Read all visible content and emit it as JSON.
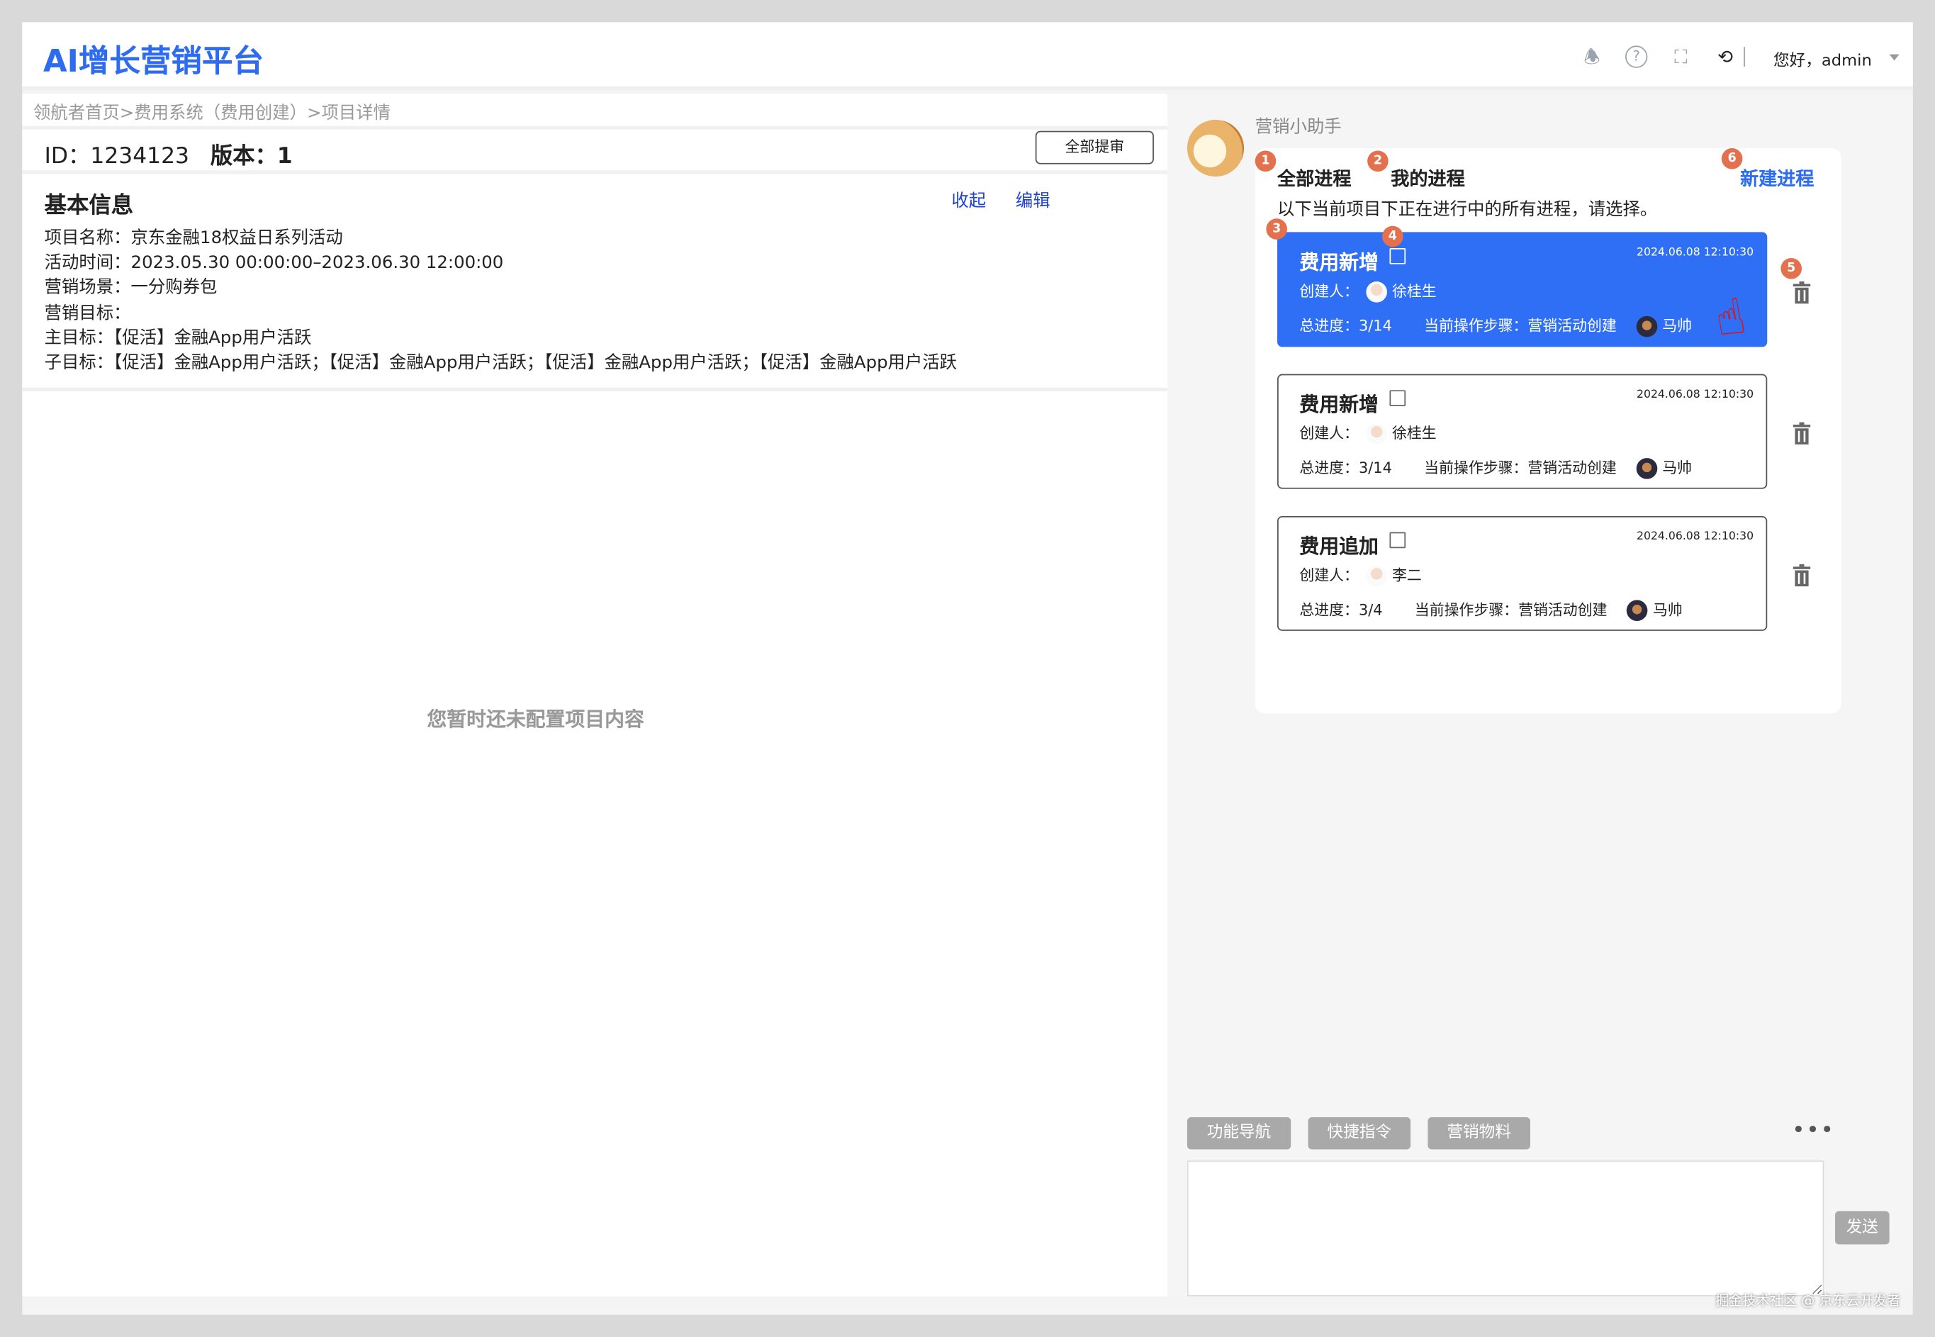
{
  "header": {
    "title": "AI增长营销平台",
    "greeting": "您好，admin",
    "icons": [
      "bell-icon",
      "help-icon",
      "fullscreen-icon",
      "history-icon"
    ]
  },
  "left": {
    "breadcrumb": "领航者首页>费用系统（费用创建）>项目详情",
    "id_label": "ID：1234123",
    "version_label": "版本：1",
    "submit_all": "全部提审",
    "basic_info": {
      "title": "基本信息",
      "collapse": "收起",
      "edit": "编辑",
      "lines": [
        "项目名称：京东金融18权益日系列活动",
        "活动时间：2023.05.30 00:00:00–2023.06.30 12:00:00",
        "营销场景：一分购券包",
        "营销目标：",
        "主目标：【促活】金融App用户活跃",
        "子目标：【促活】金融App用户活跃；【促活】金融App用户活跃；【促活】金融App用户活跃；【促活】金融App用户活跃"
      ]
    },
    "empty_text": "您暂时还未配置项目内容"
  },
  "assistant": {
    "name": "营销小助手",
    "tabs": [
      "全部进程",
      "我的进程"
    ],
    "new_process": "新建进程",
    "description": "以下当前项目下正在进行中的所有进程，请选择。",
    "badges": [
      "1",
      "2",
      "3",
      "4",
      "5",
      "6"
    ],
    "processes": [
      {
        "name": "费用新增",
        "time": "2024.06.08  12:10:30",
        "creator_label": "创建人：",
        "creator": "徐桂生",
        "progress": "总进度：3/14",
        "step": "当前操作步骤：营销活动创建",
        "operator": "马帅",
        "selected": true
      },
      {
        "name": "费用新增",
        "time": "2024.06.08  12:10:30",
        "creator_label": "创建人：",
        "creator": "徐桂生",
        "progress": "总进度：3/14",
        "step": "当前操作步骤：营销活动创建",
        "operator": "马帅",
        "selected": false
      },
      {
        "name": "费用追加",
        "time": "2024.06.08  12:10:30",
        "creator_label": "创建人：",
        "creator": "李二",
        "progress": "总进度：3/4",
        "step": "当前操作步骤：营销活动创建",
        "operator": "马帅",
        "selected": false
      }
    ],
    "quick_buttons": [
      "功能导航",
      "快捷指令",
      "营销物料"
    ],
    "more": "•••",
    "send": "发送"
  },
  "watermark": "掘金技术社区 @ 京东云开发者",
  "colors": {
    "brand": "#2d6cf0",
    "selected_card": "#2e6ff6",
    "badge": "#e4714d",
    "link": "#1a3fe0"
  }
}
